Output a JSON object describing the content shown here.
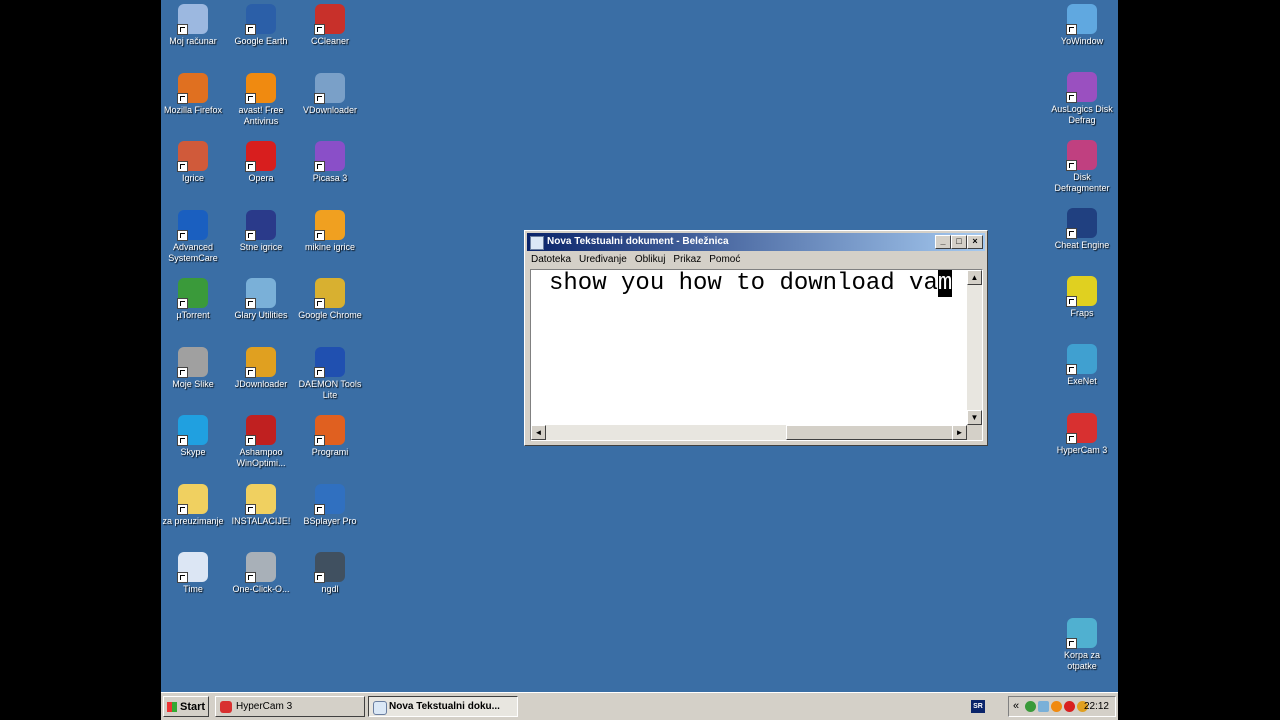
{
  "desktop": {
    "left_icons": [
      {
        "label": "Moj računar",
        "icon": "computer-icon",
        "color": "#9cb8e0"
      },
      {
        "label": "Google Earth",
        "icon": "google-earth-icon",
        "color": "#2b5fa8"
      },
      {
        "label": "CCleaner",
        "icon": "ccleaner-icon",
        "color": "#c8302a"
      },
      {
        "label": "Mozilla Firefox",
        "icon": "firefox-icon",
        "color": "#e07020"
      },
      {
        "label": "avast! Free Antivirus",
        "icon": "avast-icon",
        "color": "#f08a10"
      },
      {
        "label": "VDownloader",
        "icon": "vdownloader-icon",
        "color": "#7aa0c8"
      },
      {
        "label": "Igrice",
        "icon": "games-icon",
        "color": "#d05a3a"
      },
      {
        "label": "Opera",
        "icon": "opera-icon",
        "color": "#d81e1e"
      },
      {
        "label": "Picasa 3",
        "icon": "picasa-icon",
        "color": "#8a4fc8"
      },
      {
        "label": "Advanced SystemCare",
        "icon": "advanced-systemcare-icon",
        "color": "#1a5fc0"
      },
      {
        "label": "Stne igrice",
        "icon": "phone-games-icon",
        "color": "#2a3a8a"
      },
      {
        "label": "mikine igrice",
        "icon": "games-icon",
        "color": "#f0a020"
      },
      {
        "label": "µTorrent",
        "icon": "utorrent-icon",
        "color": "#3a9a3a"
      },
      {
        "label": "Glary Utilities",
        "icon": "glary-utilities-icon",
        "color": "#7ab0d8"
      },
      {
        "label": "Google Chrome",
        "icon": "chrome-icon",
        "color": "#d8b030"
      },
      {
        "label": "Moje Slike",
        "icon": "camera-icon",
        "color": "#a0a0a0"
      },
      {
        "label": "JDownloader",
        "icon": "jdownloader-icon",
        "color": "#e0a020"
      },
      {
        "label": "DAEMON Tools Lite",
        "icon": "daemon-tools-icon",
        "color": "#2050b0"
      },
      {
        "label": "Skype",
        "icon": "skype-icon",
        "color": "#20a0e0"
      },
      {
        "label": "Ashampoo WinOptimi...",
        "icon": "ashampoo-icon",
        "color": "#c02020"
      },
      {
        "label": "Programi",
        "icon": "programs-icon",
        "color": "#e06020"
      },
      {
        "label": "za preuzimanje",
        "icon": "folder-icon",
        "color": "#f0d060"
      },
      {
        "label": "INSTALACIJE!",
        "icon": "folder-icon",
        "color": "#f0d060"
      },
      {
        "label": "BSplayer Pro",
        "icon": "bsplayer-icon",
        "color": "#3070c0"
      },
      {
        "label": "Time",
        "icon": "document-icon",
        "color": "#dce6f4"
      },
      {
        "label": "One-Click-O...",
        "icon": "one-click-icon",
        "color": "#a8b0b8"
      },
      {
        "label": "ngdl",
        "icon": "ngdl-icon",
        "color": "#405060"
      }
    ],
    "right_icons": [
      {
        "label": "YoWindow",
        "icon": "yowindow-icon",
        "color": "#60a8e0"
      },
      {
        "label": "AusLogics Disk Defrag",
        "icon": "auslogics-icon",
        "color": "#9a50c0"
      },
      {
        "label": "Disk Defragmenter",
        "icon": "disk-defragmenter-icon",
        "color": "#c04080"
      },
      {
        "label": "Cheat Engine",
        "icon": "cheat-engine-icon",
        "color": "#204080"
      },
      {
        "label": "Fraps",
        "icon": "fraps-icon",
        "color": "#e0d020"
      },
      {
        "label": "ExeNet",
        "icon": "exenet-icon",
        "color": "#40a0d0"
      },
      {
        "label": "HyperCam 3",
        "icon": "hypercam-icon",
        "color": "#d83030"
      },
      {
        "label": "Korpa za otpatke",
        "icon": "recycle-bin-icon",
        "color": "#50b0d0"
      }
    ]
  },
  "notepad": {
    "title": "Nova Tekstualni dokument - Beležnica",
    "menu": [
      "Datoteka",
      "Uređivanje",
      "Oblikuj",
      "Prikaz",
      "Pomoć"
    ],
    "text": "show you how to download va",
    "cursor_char": "m"
  },
  "taskbar": {
    "start_label": "Start",
    "tasks": [
      {
        "label": "HyperCam 3",
        "icon": "hypercam-icon",
        "active": false
      },
      {
        "label": "Nova Tekstualni doku...",
        "icon": "notepad-icon",
        "active": true
      }
    ],
    "language": "SR",
    "tray_expand": "«",
    "clock": "22:12"
  },
  "colors": {
    "desktop": "#3a6ea5",
    "titlebar_start": "#0a246a",
    "titlebar_end": "#a6caf0",
    "chrome": "#d4d0c8"
  }
}
